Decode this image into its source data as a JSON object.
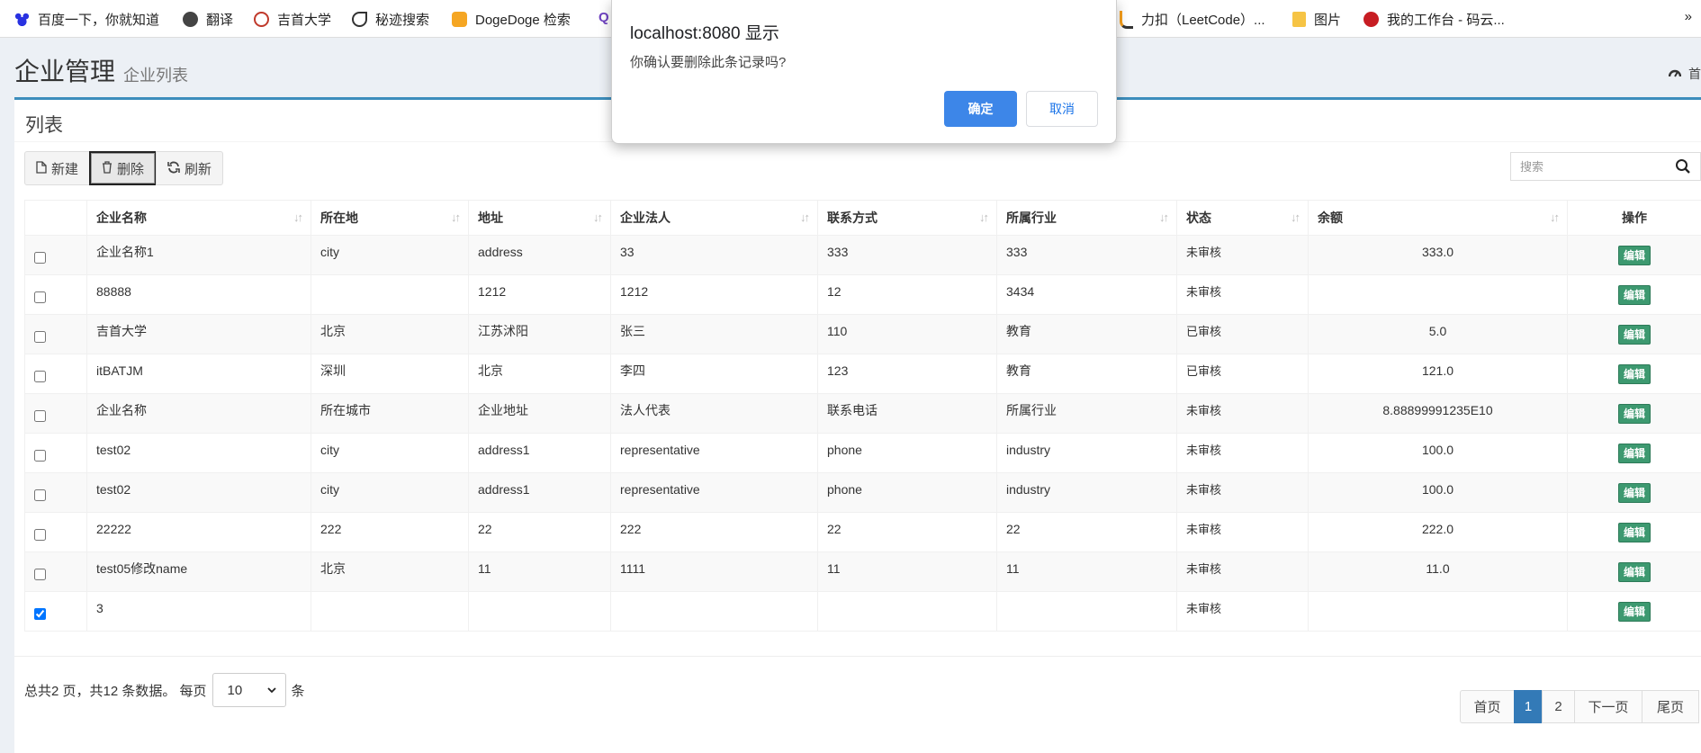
{
  "bookmarks": {
    "items": [
      {
        "label": "百度一下，你就知道",
        "icon": "baidu-paw-icon",
        "color": "#2932e1"
      },
      {
        "label": "翻译",
        "icon": "globe-icon",
        "color": "#444444"
      },
      {
        "label": "吉首大学",
        "icon": "university-icon",
        "color": "#c0392b"
      },
      {
        "label": "秘迹搜索",
        "icon": "mijisou-icon",
        "color": "#333333"
      },
      {
        "label": "DogeDoge 检索",
        "icon": "doge-icon",
        "color": "#f5a623"
      },
      {
        "label": "Q",
        "icon": "search-q-icon",
        "color": "#6f42c1"
      },
      {
        "label": "力扣（LeetCode）...",
        "icon": "leetcode-icon",
        "color": "#f89f1b"
      },
      {
        "label": "图片",
        "icon": "folder-icon",
        "color": "#f6c445"
      },
      {
        "label": "我的工作台 - 码云...",
        "icon": "gitee-icon",
        "color": "#c71d23"
      }
    ],
    "more": "»"
  },
  "header": {
    "title": "企业管理",
    "subtitle": "企业列表",
    "home": "首"
  },
  "box": {
    "title": "列表",
    "toolbar": {
      "new_label": "新建",
      "delete_label": "删除",
      "refresh_label": "刷新"
    },
    "search": {
      "placeholder": "搜索"
    }
  },
  "table": {
    "columns": [
      "企业名称",
      "所在地",
      "地址",
      "企业法人",
      "联系方式",
      "所属行业",
      "状态",
      "余额",
      "操作"
    ],
    "edit_label": "编辑",
    "rows": [
      {
        "checked": false,
        "name": "企业名称1",
        "city": "city",
        "address": "address",
        "legal": "33",
        "contact": "333",
        "industry": "333",
        "status": "未审核",
        "balance": "333.0"
      },
      {
        "checked": false,
        "name": "88888",
        "city": "",
        "address": "1212",
        "legal": "1212",
        "contact": "12",
        "industry": "3434",
        "status": "未审核",
        "balance": ""
      },
      {
        "checked": false,
        "name": "吉首大学",
        "city": "北京",
        "address": "江苏沭阳",
        "legal": "张三",
        "contact": "110",
        "industry": "教育",
        "status": "已审核",
        "balance": "5.0"
      },
      {
        "checked": false,
        "name": "itBATJM",
        "city": "深圳",
        "address": "北京",
        "legal": "李四",
        "contact": "123",
        "industry": "教育",
        "status": "已审核",
        "balance": "121.0"
      },
      {
        "checked": false,
        "name": "企业名称",
        "city": "所在城市",
        "address": "企业地址",
        "legal": "法人代表",
        "contact": "联系电话",
        "industry": "所属行业",
        "status": "未审核",
        "balance": "8.88899991235E10"
      },
      {
        "checked": false,
        "name": "test02",
        "city": "city",
        "address": "address1",
        "legal": "representative",
        "contact": "phone",
        "industry": "industry",
        "status": "未审核",
        "balance": "100.0"
      },
      {
        "checked": false,
        "name": "test02",
        "city": "city",
        "address": "address1",
        "legal": "representative",
        "contact": "phone",
        "industry": "industry",
        "status": "未审核",
        "balance": "100.0"
      },
      {
        "checked": false,
        "name": "22222",
        "city": "222",
        "address": "22",
        "legal": "222",
        "contact": "22",
        "industry": "22",
        "status": "未审核",
        "balance": "222.0"
      },
      {
        "checked": false,
        "name": "test05修改name",
        "city": "北京",
        "address": "11",
        "legal": "1111",
        "contact": "11",
        "industry": "11",
        "status": "未审核",
        "balance": "11.0"
      },
      {
        "checked": true,
        "name": "3",
        "city": "",
        "address": "",
        "legal": "",
        "contact": "",
        "industry": "",
        "status": "未审核",
        "balance": ""
      }
    ]
  },
  "footer": {
    "info_prefix": "总共2 页，共12 条数据。 每页",
    "page_size": "10",
    "info_suffix": "条",
    "pager": [
      "首页",
      "1",
      "2",
      "下一页",
      "尾页"
    ],
    "current_page": "1"
  },
  "dialog": {
    "title": "localhost:8080 显示",
    "message": "你确认要删除此条记录吗?",
    "ok_label": "确定",
    "cancel_label": "取消"
  },
  "colors": {
    "accent": "#3c8dbc",
    "edit_button": "#3d9970",
    "pager_active": "#337ab7",
    "dialog_ok": "#3d86e8"
  }
}
